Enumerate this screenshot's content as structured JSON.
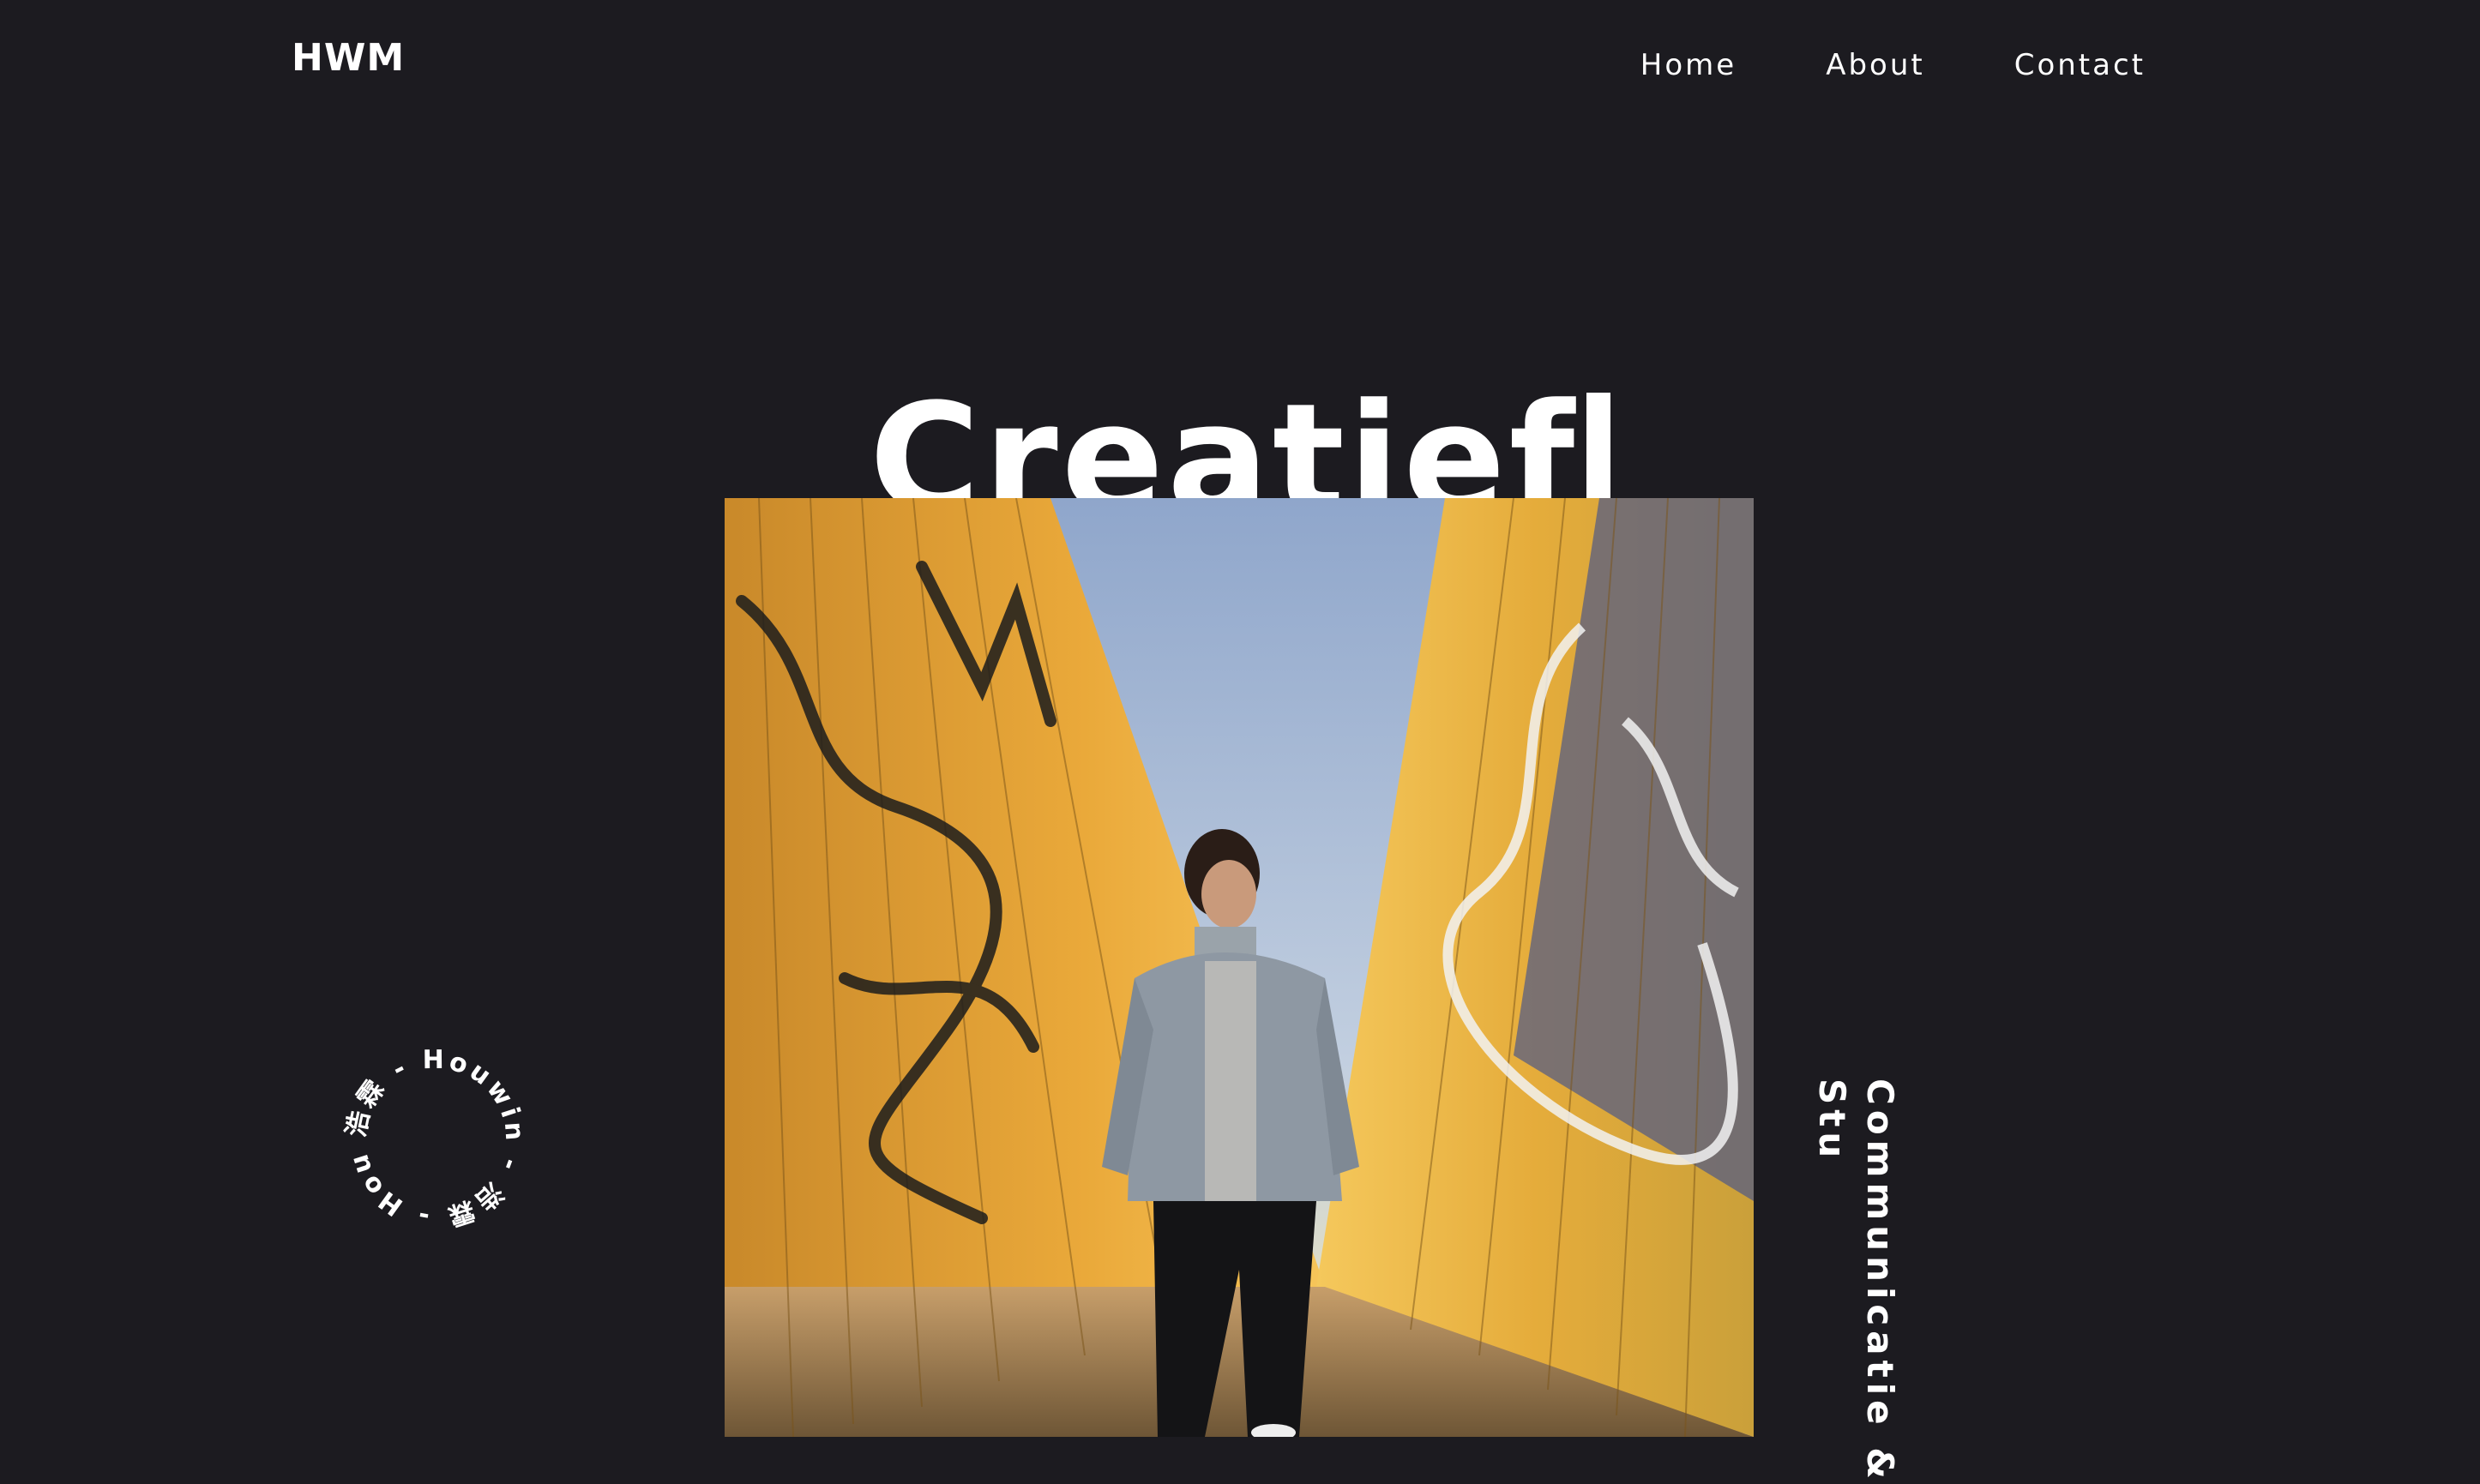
{
  "header": {
    "logo": "HWM",
    "nav": [
      {
        "label": "Home"
      },
      {
        "label": "About"
      },
      {
        "label": "Contact"
      }
    ]
  },
  "hero": {
    "title": "Creatief",
    "image_alt_icon": "person-in-graffiti-tunnel-photo",
    "badge_text": "浩霖 - Houwin - 浩霖 - Houwin - ",
    "vertical_caption": "Communicatie &\nStu"
  },
  "colors": {
    "background": "#1c1b20",
    "text": "#ffffff",
    "wall_yellow": "#e6a53a",
    "sky": "#a9bdd8"
  }
}
